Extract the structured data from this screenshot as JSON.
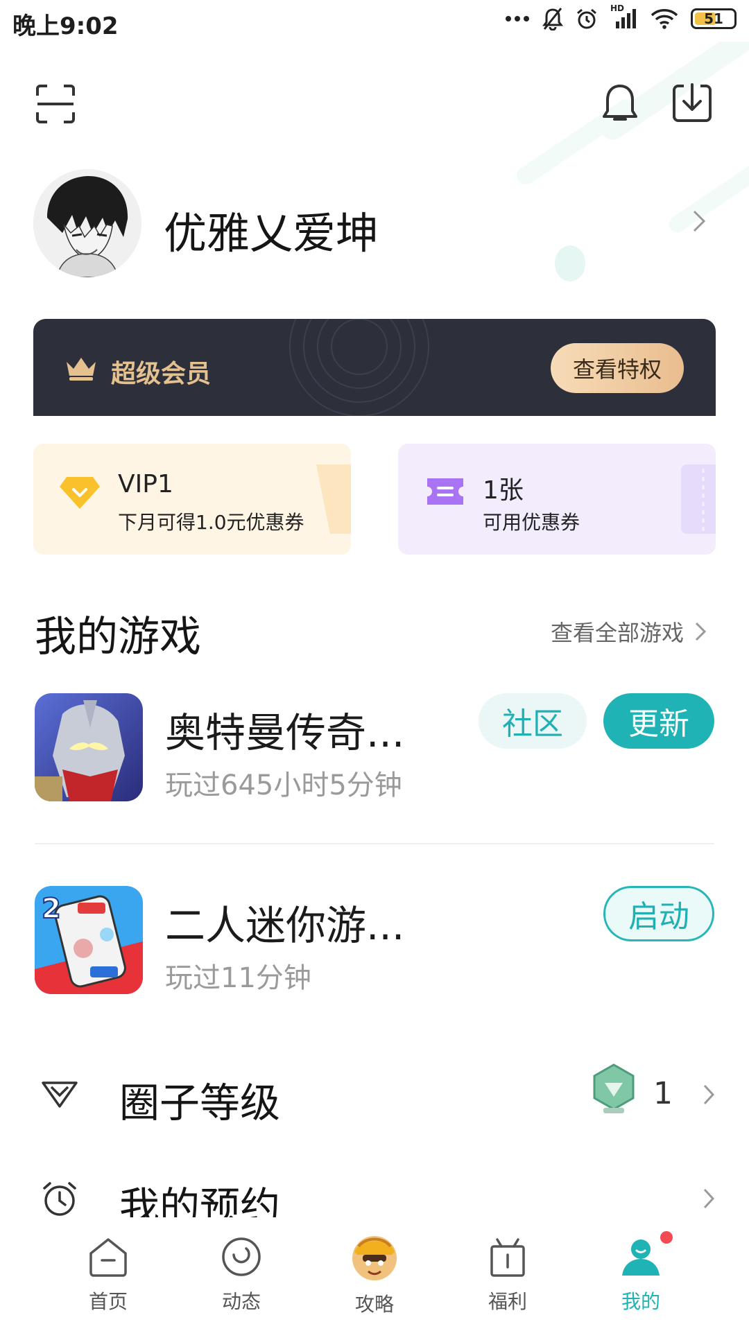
{
  "status_bar": {
    "time": "晚上9:02",
    "signal_label": "HD",
    "battery": "51",
    "icons": [
      "more-dots-icon",
      "mute-bell-icon",
      "alarm-icon",
      "signal-icon",
      "wifi-icon",
      "battery-icon"
    ]
  },
  "header": {
    "icons": [
      "scan-icon",
      "bell-icon",
      "download-icon"
    ]
  },
  "profile": {
    "username": "优雅乂爱坤"
  },
  "vip_banner": {
    "title": "超级会员",
    "button": "查看特权",
    "accent": "#e6c190"
  },
  "cards": [
    {
      "title": "VIP1",
      "subtitle": "下月可得1.0元优惠券",
      "icon": "diamond-icon"
    },
    {
      "title": "1张",
      "subtitle": "可用优惠券",
      "icon": "ticket-icon"
    }
  ],
  "my_games": {
    "title": "我的游戏",
    "view_all": "查看全部游戏",
    "games": [
      {
        "name": "奥特曼传奇...",
        "played": "玩过645小时5分钟",
        "community": "社区",
        "action": "更新"
      },
      {
        "name": "二人迷你游...",
        "played": "玩过11分钟",
        "action": "启动"
      }
    ]
  },
  "list": [
    {
      "label": "圈子等级",
      "value": "1",
      "icon": "diamond-outline-icon"
    },
    {
      "label": "我的预约",
      "icon": "alarm-clock-icon"
    }
  ],
  "tabs": [
    {
      "label": "首页",
      "icon": "home-icon"
    },
    {
      "label": "动态",
      "icon": "moment-icon"
    },
    {
      "label": "攻略",
      "icon": "character-avatar-icon"
    },
    {
      "label": "福利",
      "icon": "gift-icon"
    },
    {
      "label": "我的",
      "icon": "person-icon",
      "active": true
    }
  ],
  "colors": {
    "accent": "#1fb3b6",
    "notification_dot": "#f24b52",
    "vip_bg": "#2d2f3a"
  }
}
